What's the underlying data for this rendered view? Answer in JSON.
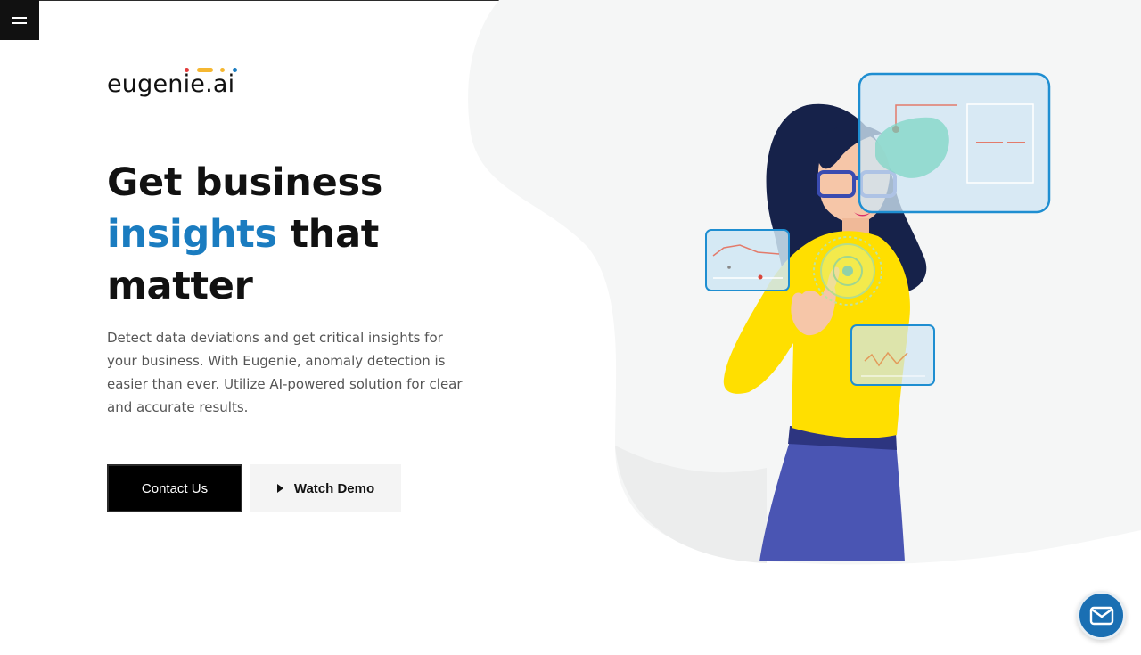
{
  "brand": {
    "name": "eugenie.ai",
    "dot_colors": [
      "#e23b3b",
      "#f5b731",
      "#f5b731",
      "#1a7cc0"
    ]
  },
  "nav": {
    "menu_icon": "hamburger-menu-icon"
  },
  "hero": {
    "title_line1": "Get business",
    "title_accent": "insights",
    "title_after_accent": " that",
    "title_line3": "matter",
    "description": "Detect data deviations and get critical insights for your business. With Eugenie, anomaly detection is easier than ever. Utilize AI-powered solution for clear and accurate results."
  },
  "actions": {
    "contact_label": "Contact Us",
    "demo_label": "Watch Demo",
    "demo_icon": "play-icon"
  },
  "chat": {
    "icon": "mail-icon"
  },
  "colors": {
    "accent": "#1a7cc0",
    "dark": "#111111",
    "sweater": "#ffdf00",
    "pants": "#4a55b3",
    "panel": "#cfe6f3",
    "panel_border": "#1e8ed1",
    "blob": "#f5f6f6"
  }
}
